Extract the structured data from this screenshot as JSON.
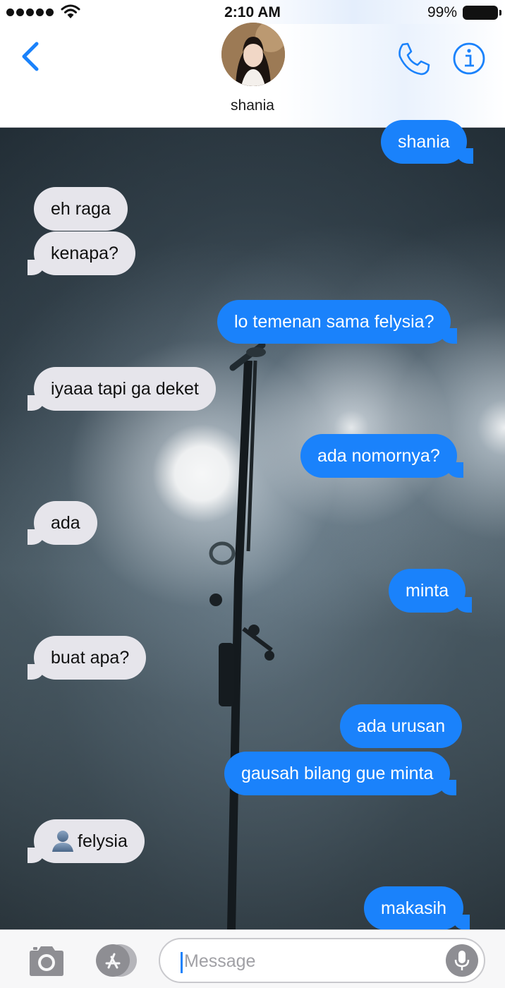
{
  "status_bar": {
    "time": "2:10 AM",
    "battery_percent": "99%",
    "signal_bars": 5
  },
  "header": {
    "contact_name": "shania"
  },
  "messages": [
    {
      "text": "shania",
      "from": "me"
    },
    {
      "text": "eh raga",
      "from": "them"
    },
    {
      "text": "kenapa?",
      "from": "them"
    },
    {
      "text": "lo temenan sama felysia?",
      "from": "me"
    },
    {
      "text": "iyaaa tapi ga deket",
      "from": "them"
    },
    {
      "text": "ada nomornya?",
      "from": "me"
    },
    {
      "text": "ada",
      "from": "them"
    },
    {
      "text": "minta",
      "from": "me"
    },
    {
      "text": "buat apa?",
      "from": "them"
    },
    {
      "text": "ada urusan",
      "from": "me"
    },
    {
      "text": "gausah bilang gue minta",
      "from": "me"
    },
    {
      "text": "felysia",
      "from": "them",
      "type": "contact-card"
    },
    {
      "text": "makasih",
      "from": "me"
    }
  ],
  "input_bar": {
    "placeholder": "Message"
  },
  "icons": {
    "back": "chevron-left-icon",
    "call": "phone-icon",
    "info": "info-icon",
    "camera": "camera-icon",
    "apps": "app-store-icon",
    "mic": "microphone-icon",
    "contact": "person-icon"
  },
  "colors": {
    "accent": "#1a82fb",
    "incoming_bubble": "#e6e5eb",
    "outgoing_bubble": "#1a82fb"
  }
}
